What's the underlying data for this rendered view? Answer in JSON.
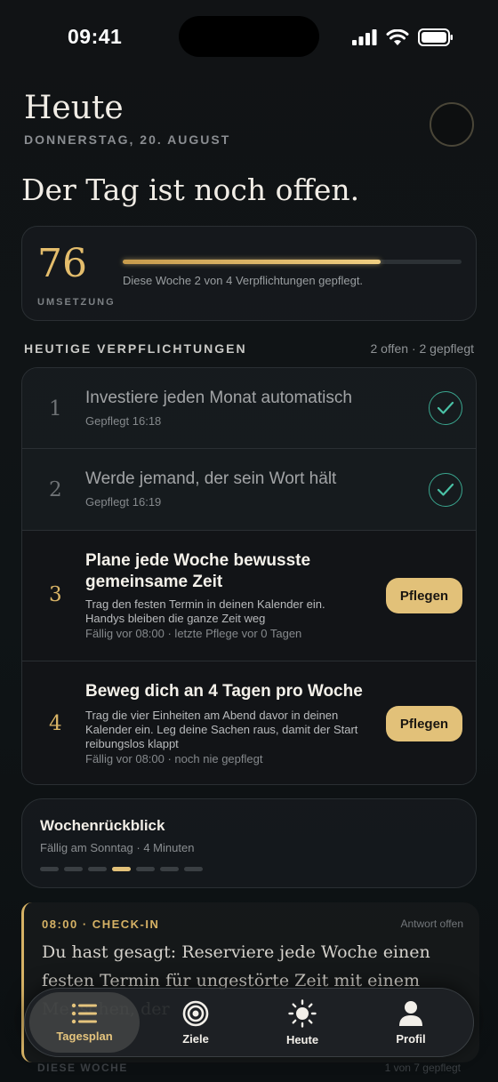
{
  "status": {
    "time": "09:41"
  },
  "header": {
    "title": "Heute",
    "date": "DONNERSTAG, 20. AUGUST",
    "headline": "Der Tag ist noch offen."
  },
  "score": {
    "value": "76",
    "label": "UMSETZUNG",
    "progress_fraction": 0.76,
    "progress_text": "Diese Woche 2 von 4 Verpflichtungen gepflegt."
  },
  "commitments": {
    "title": "HEUTIGE VERPFLICHTUNGEN",
    "meta": "2 offen · 2 gepflegt",
    "items": [
      {
        "num": "1",
        "title": "Investiere jeden Monat automatisch",
        "sub": "Gepflegt 16:18",
        "done": true
      },
      {
        "num": "2",
        "title": "Werde jemand, der sein Wort hält",
        "sub": "Gepflegt 16:19",
        "done": true
      },
      {
        "num": "3",
        "title": "Plane jede Woche bewusste gemeinsame Zeit",
        "desc": "Trag den festen Termin in deinen Kalender ein. Handys bleiben die ganze Zeit weg",
        "due": "Fällig vor 08:00 · letzte Pflege vor 0 Tagen",
        "action": "Pflegen",
        "done": false
      },
      {
        "num": "4",
        "title": "Beweg dich an 4 Tagen pro Woche",
        "desc": "Trag die vier Einheiten am Abend davor in deinen Kalender ein. Leg deine Sachen raus, damit der Start reibungslos klappt",
        "due": "Fällig vor 08:00 · noch nie gepflegt",
        "action": "Pflegen",
        "done": false
      }
    ]
  },
  "review": {
    "title": "Wochenrückblick",
    "sub": "Fällig am Sonntag · 4 Minuten",
    "steps_total": 7,
    "step_active": 4
  },
  "checkin": {
    "label": "08:00 · CHECK-IN",
    "status": "Antwort offen",
    "text": "Du hast gesagt: Reserviere jede Woche einen festen Termin für ungestörte Zeit mit einem Menschen, der"
  },
  "week": {
    "label": "DIESE WOCHE",
    "meta": "1 von 7 gepflegt"
  },
  "tabbar": {
    "tabs": [
      {
        "label": "Tagesplan",
        "icon": "list-icon",
        "active": true
      },
      {
        "label": "Ziele",
        "icon": "target-icon",
        "active": false
      },
      {
        "label": "Heute",
        "icon": "sun-icon",
        "active": false
      },
      {
        "label": "Profil",
        "icon": "person-icon",
        "active": false
      }
    ]
  },
  "colors": {
    "accent": "#e2c179",
    "check": "#3aa58e",
    "background": "#111315"
  }
}
